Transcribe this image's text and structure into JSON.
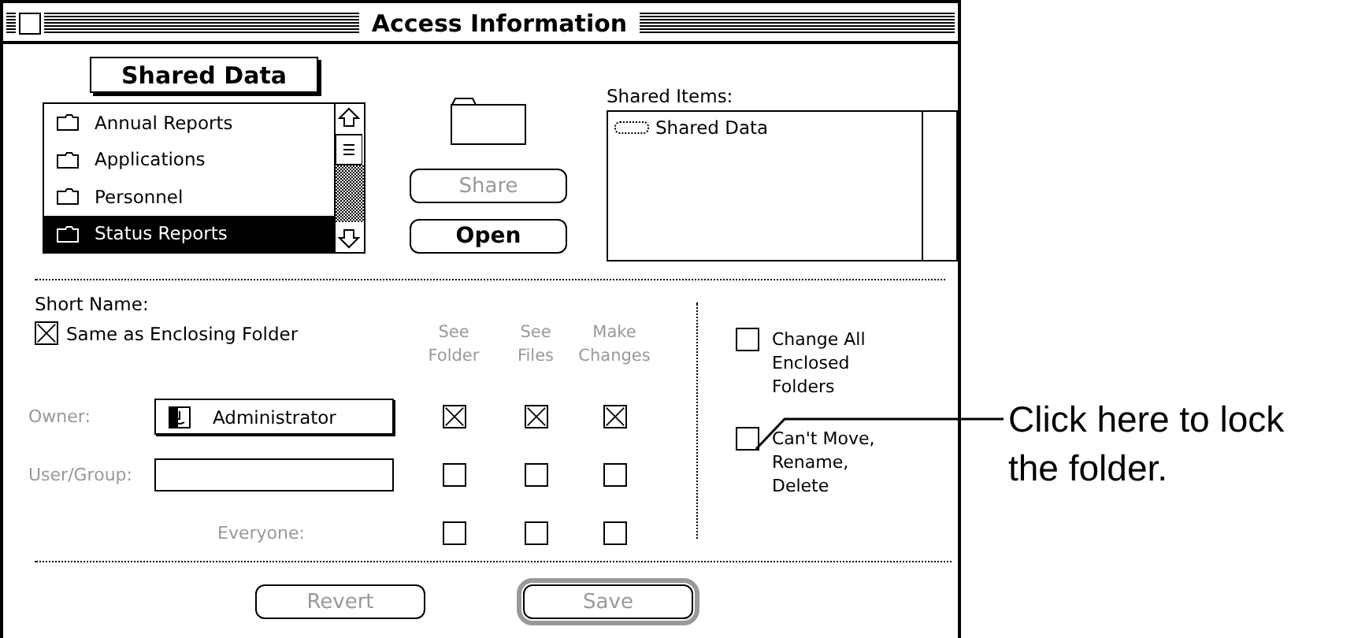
{
  "window": {
    "title": "Access Information"
  },
  "folder_popup": {
    "label": "Shared Data"
  },
  "folder_list": {
    "items": [
      {
        "label": "Annual Reports",
        "selected": false
      },
      {
        "label": "Applications",
        "selected": false
      },
      {
        "label": "Personnel",
        "selected": false
      },
      {
        "label": "Status Reports",
        "selected": true
      }
    ]
  },
  "share_button": {
    "label": "Share",
    "disabled": true
  },
  "open_button": {
    "label": "Open",
    "disabled": false
  },
  "shared_items": {
    "label": "Shared Items:",
    "items": [
      "Shared Data"
    ]
  },
  "short_name": {
    "label": "Short Name:"
  },
  "same_as_enclosing": {
    "label": "Same as Enclosing Folder",
    "checked": true
  },
  "privilege_columns": [
    {
      "label": "See\nFolder",
      "disabled": true
    },
    {
      "label": "See\nFiles",
      "disabled": true
    },
    {
      "label": "Make\nChanges",
      "disabled": true
    }
  ],
  "privilege_rows": [
    {
      "kind": "owner",
      "label": "Owner:",
      "disabled": true,
      "value": "Administrator",
      "checks": [
        {
          "checked": true
        },
        {
          "checked": true
        },
        {
          "checked": true
        }
      ]
    },
    {
      "kind": "field",
      "label": "User/Group:",
      "disabled": true,
      "checks": [
        {
          "checked": false
        },
        {
          "checked": false
        },
        {
          "checked": false
        }
      ]
    },
    {
      "kind": "plain",
      "label": "Everyone:",
      "disabled": true,
      "checks": [
        {
          "checked": false
        },
        {
          "checked": false
        },
        {
          "checked": false
        }
      ]
    }
  ],
  "options": [
    {
      "label": "Change All\nEnclosed\nFolders",
      "checked": false
    },
    {
      "label": "Can't Move,\nRename,\nDelete",
      "checked": false
    }
  ],
  "footer_buttons": [
    {
      "label": "Revert",
      "disabled": true,
      "default": false
    },
    {
      "label": "Save",
      "disabled": true,
      "default": true
    }
  ],
  "callout": {
    "text": "Click here to lock\nthe folder."
  }
}
